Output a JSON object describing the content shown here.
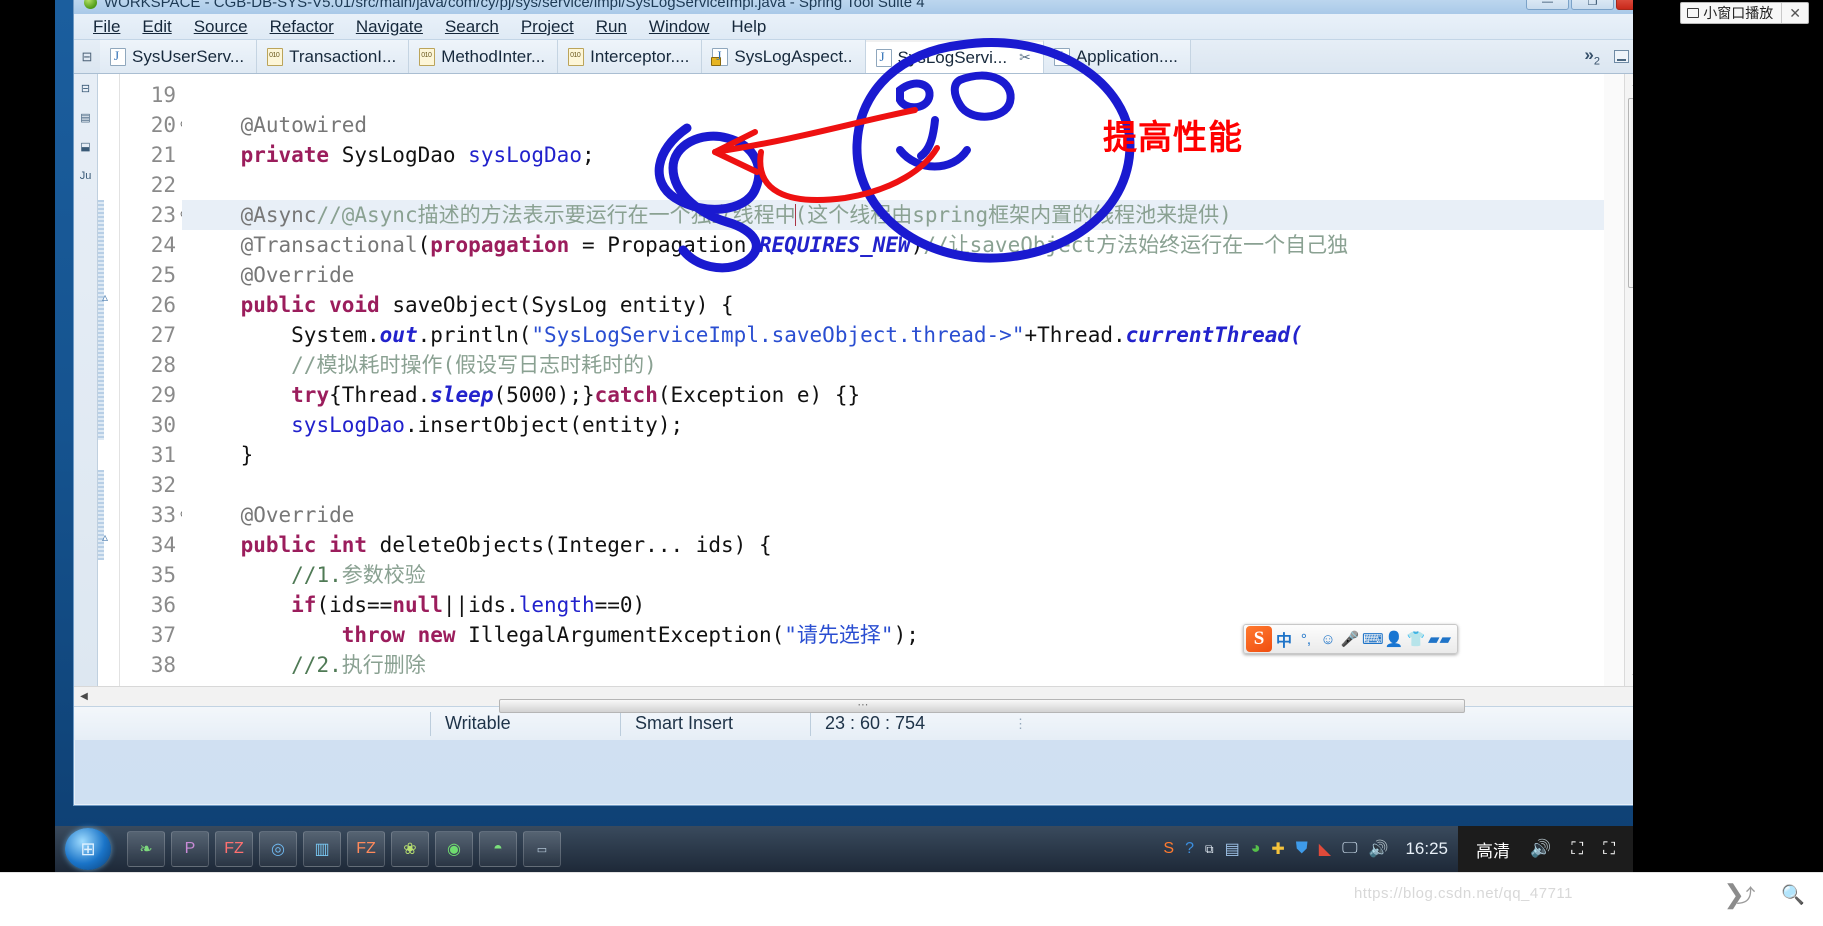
{
  "window": {
    "title": "WORKSPACE - CGB-DB-SYS-V5.01/src/main/java/com/cy/pj/sys/service/impl/SysLogServiceImpl.java - Spring Tool Suite 4",
    "buttons": {
      "minimize": "—",
      "restore": "❐",
      "close": "✕"
    }
  },
  "menubar": {
    "items": [
      "File",
      "Edit",
      "Source",
      "Refactor",
      "Navigate",
      "Search",
      "Project",
      "Run",
      "Window",
      "Help"
    ]
  },
  "tabs": {
    "items": [
      {
        "label": "SysUserServ...",
        "icon": "java-file-icon",
        "active": false,
        "closable": false
      },
      {
        "label": "TransactionI...",
        "icon": "class-file-icon",
        "active": false,
        "closable": false
      },
      {
        "label": "MethodInter...",
        "icon": "class-file-icon",
        "active": false,
        "closable": false
      },
      {
        "label": "Interceptor....",
        "icon": "class-file-icon",
        "active": false,
        "closable": false
      },
      {
        "label": "SysLogAspect..",
        "icon": "java-file-locked-icon",
        "active": false,
        "closable": false
      },
      {
        "label": "SysLogServi...",
        "icon": "java-file-icon",
        "active": true,
        "closable": true
      },
      {
        "label": "Application....",
        "icon": "java-file-icon",
        "active": false,
        "closable": false
      }
    ],
    "overflow_chevron": "»",
    "overflow_count": "2",
    "close_glyph": "✂"
  },
  "editor": {
    "lines": [
      {
        "num": "19",
        "fold": "",
        "highlight": false,
        "marker": "",
        "tokens": []
      },
      {
        "num": "20",
        "fold": "⊖",
        "highlight": false,
        "marker": "",
        "tokens": [
          {
            "t": "    ",
            "c": "plain"
          },
          {
            "t": "@Autowired",
            "c": "anno"
          }
        ]
      },
      {
        "num": "21",
        "fold": "",
        "highlight": false,
        "marker": "",
        "tokens": [
          {
            "t": "    ",
            "c": "plain"
          },
          {
            "t": "private",
            "c": "kw"
          },
          {
            "t": " SysLogDao ",
            "c": "plain"
          },
          {
            "t": "sysLogDao",
            "c": "fld"
          },
          {
            "t": ";",
            "c": "plain"
          }
        ]
      },
      {
        "num": "22",
        "fold": "",
        "highlight": false,
        "marker": "",
        "tokens": []
      },
      {
        "num": "23",
        "fold": "⊖",
        "highlight": true,
        "marker": "",
        "tokens": [
          {
            "t": "    ",
            "c": "plain"
          },
          {
            "t": "@Async",
            "c": "anno"
          },
          {
            "t": "//@Async描述的方法表示要运行在一个独立线程中",
            "c": "cmt-cn"
          },
          {
            "t": "CARET",
            "c": "caret"
          },
          {
            "t": "(这个线程由spring框架内置的线程池来提供)",
            "c": "cmt-cn"
          }
        ]
      },
      {
        "num": "24",
        "fold": "",
        "highlight": false,
        "marker": "",
        "tokens": [
          {
            "t": "    ",
            "c": "plain"
          },
          {
            "t": "@Transactional",
            "c": "anno"
          },
          {
            "t": "(",
            "c": "plain"
          },
          {
            "t": "propagation",
            "c": "kw"
          },
          {
            "t": " = Propagation.",
            "c": "plain"
          },
          {
            "t": "REQUIRES_NEW",
            "c": "stat"
          },
          {
            "t": ")",
            "c": "plain"
          },
          {
            "t": "//让saveObject方法始终运行在一个自己独",
            "c": "cmt-cn"
          }
        ]
      },
      {
        "num": "25",
        "fold": "",
        "highlight": false,
        "marker": "",
        "tokens": [
          {
            "t": "    ",
            "c": "plain"
          },
          {
            "t": "@Override",
            "c": "anno"
          }
        ]
      },
      {
        "num": "26",
        "fold": "",
        "highlight": false,
        "marker": "▵",
        "tokens": [
          {
            "t": "    ",
            "c": "plain"
          },
          {
            "t": "public",
            "c": "kw"
          },
          {
            "t": " ",
            "c": "plain"
          },
          {
            "t": "void",
            "c": "kw"
          },
          {
            "t": " saveObject(SysLog entity) {",
            "c": "plain"
          }
        ]
      },
      {
        "num": "27",
        "fold": "",
        "highlight": false,
        "marker": "",
        "tokens": [
          {
            "t": "        System.",
            "c": "plain"
          },
          {
            "t": "out",
            "c": "stat"
          },
          {
            "t": ".println(",
            "c": "plain"
          },
          {
            "t": "\"SysLogServiceImpl.saveObject.thread->\"",
            "c": "str"
          },
          {
            "t": "+Thread.",
            "c": "plain"
          },
          {
            "t": "currentThread(",
            "c": "stat"
          }
        ]
      },
      {
        "num": "28",
        "fold": "",
        "highlight": false,
        "marker": "",
        "tokens": [
          {
            "t": "        ",
            "c": "plain"
          },
          {
            "t": "//模拟耗时操作(假设写日志时耗时的)",
            "c": "cmt-cn"
          }
        ]
      },
      {
        "num": "29",
        "fold": "",
        "highlight": false,
        "marker": "",
        "tokens": [
          {
            "t": "        ",
            "c": "plain"
          },
          {
            "t": "try",
            "c": "kw"
          },
          {
            "t": "{Thread.",
            "c": "plain"
          },
          {
            "t": "sleep",
            "c": "stat"
          },
          {
            "t": "(5000);}",
            "c": "plain"
          },
          {
            "t": "catch",
            "c": "kw"
          },
          {
            "t": "(Exception e) {}",
            "c": "plain"
          }
        ]
      },
      {
        "num": "30",
        "fold": "",
        "highlight": false,
        "marker": "",
        "tokens": [
          {
            "t": "        ",
            "c": "plain"
          },
          {
            "t": "sysLogDao",
            "c": "fld"
          },
          {
            "t": ".insertObject(entity);",
            "c": "plain"
          }
        ]
      },
      {
        "num": "31",
        "fold": "",
        "highlight": false,
        "marker": "",
        "tokens": [
          {
            "t": "    }",
            "c": "plain"
          }
        ]
      },
      {
        "num": "32",
        "fold": "",
        "highlight": false,
        "marker": "",
        "tokens": []
      },
      {
        "num": "33",
        "fold": "⊖",
        "highlight": false,
        "marker": "",
        "tokens": [
          {
            "t": "    ",
            "c": "plain"
          },
          {
            "t": "@Override",
            "c": "anno"
          }
        ]
      },
      {
        "num": "34",
        "fold": "",
        "highlight": false,
        "marker": "▵",
        "tokens": [
          {
            "t": "    ",
            "c": "plain"
          },
          {
            "t": "public",
            "c": "kw"
          },
          {
            "t": " ",
            "c": "plain"
          },
          {
            "t": "int",
            "c": "kw"
          },
          {
            "t": " deleteObjects(Integer... ids) {",
            "c": "plain"
          }
        ]
      },
      {
        "num": "35",
        "fold": "",
        "highlight": false,
        "marker": "",
        "tokens": [
          {
            "t": "        ",
            "c": "plain"
          },
          {
            "t": "//1.",
            "c": "cmt"
          },
          {
            "t": "参数校验",
            "c": "cmt-cn"
          }
        ]
      },
      {
        "num": "36",
        "fold": "",
        "highlight": false,
        "marker": "",
        "tokens": [
          {
            "t": "        ",
            "c": "plain"
          },
          {
            "t": "if",
            "c": "kw"
          },
          {
            "t": "(ids==",
            "c": "plain"
          },
          {
            "t": "null",
            "c": "kw"
          },
          {
            "t": "||ids.",
            "c": "plain"
          },
          {
            "t": "length",
            "c": "fld"
          },
          {
            "t": "==0)",
            "c": "plain"
          }
        ]
      },
      {
        "num": "37",
        "fold": "",
        "highlight": false,
        "marker": "",
        "tokens": [
          {
            "t": "            ",
            "c": "plain"
          },
          {
            "t": "throw",
            "c": "kw"
          },
          {
            "t": " ",
            "c": "plain"
          },
          {
            "t": "new",
            "c": "kw"
          },
          {
            "t": " IllegalArgumentException(",
            "c": "plain"
          },
          {
            "t": "\"请先选择\"",
            "c": "str"
          },
          {
            "t": ");",
            "c": "plain"
          }
        ]
      },
      {
        "num": "38",
        "fold": "",
        "highlight": false,
        "marker": "",
        "tokens": [
          {
            "t": "        ",
            "c": "plain"
          },
          {
            "t": "//2.",
            "c": "cmt"
          },
          {
            "t": "执行删除",
            "c": "cmt-cn"
          }
        ]
      }
    ]
  },
  "statusbar": {
    "writable": "Writable",
    "insert_mode": "Smart Insert",
    "position": "23 : 60 : 754",
    "dots": "⋮"
  },
  "annotation": {
    "text": "提高性能",
    "color": "#ff0000",
    "ink_blue": "#1a1ad0",
    "ink_red": "#ee1111"
  },
  "ime": {
    "logo": "S",
    "mode": "中",
    "punct": "°,",
    "icons": [
      "smiley-icon",
      "microphone-icon",
      "keyboard-icon",
      "user-icon",
      "skin-icon",
      "apps-icon"
    ]
  },
  "taskbar": {
    "start": "⊞",
    "clock": "16:25",
    "items": [
      "app-1",
      "app-2",
      "app-3",
      "app-4",
      "app-5",
      "app-6",
      "app-7",
      "app-8"
    ],
    "tray": [
      "sogou-icon",
      "help-icon",
      "network-icon",
      "monitor-icon",
      "wechat-icon",
      "update-icon",
      "shield-icon",
      "a-icon",
      "display-icon",
      "volume-icon"
    ]
  },
  "player": {
    "quality": "高清",
    "volume_icon": "volume-icon",
    "pip_icon": "pip-icon",
    "fullscreen_icon": "fullscreen-icon"
  },
  "pip_float": {
    "label": "小窗口播放",
    "close": "✕"
  },
  "footer": {
    "watermark": "https://blog.csdn.net/qq_47711",
    "scroll_glyph": "❯"
  }
}
